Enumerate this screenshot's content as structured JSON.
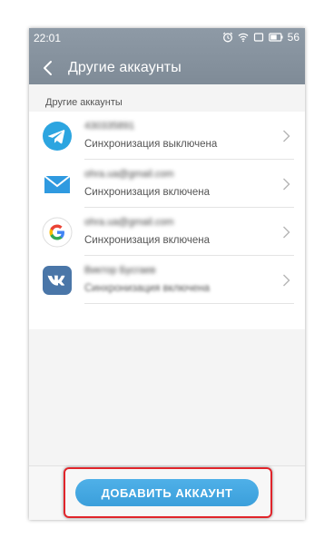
{
  "status_bar": {
    "time": "22:01",
    "battery": "56",
    "icons": [
      "alarm-icon",
      "wifi-icon",
      "screen-icon",
      "battery-icon"
    ]
  },
  "app_bar": {
    "title": "Другие аккаунты"
  },
  "section": {
    "label": "Другие аккаунты"
  },
  "accounts": [
    {
      "icon": "telegram-icon",
      "name": "430335891",
      "status": "Синхронизация выключена",
      "accent": "#2ca5e0"
    },
    {
      "icon": "mail-icon",
      "name": "ohra.ua@gmail.com",
      "status": "Синхронизация включена",
      "accent": "#2f9ae0"
    },
    {
      "icon": "google-icon",
      "name": "ohra.ua@gmail.com",
      "status": "Синхронизация включена",
      "accent": "#4285f4"
    },
    {
      "icon": "vk-icon",
      "name": "Виктор Бусгаев",
      "status": "Синхронизация включена",
      "accent": "#4a76a8"
    }
  ],
  "bottom": {
    "add_button": "ДОБАВИТЬ АККАУНТ"
  },
  "colors": {
    "appbar": "#8a96a2",
    "button": "#45a8e2",
    "highlight": "#e0242a"
  }
}
